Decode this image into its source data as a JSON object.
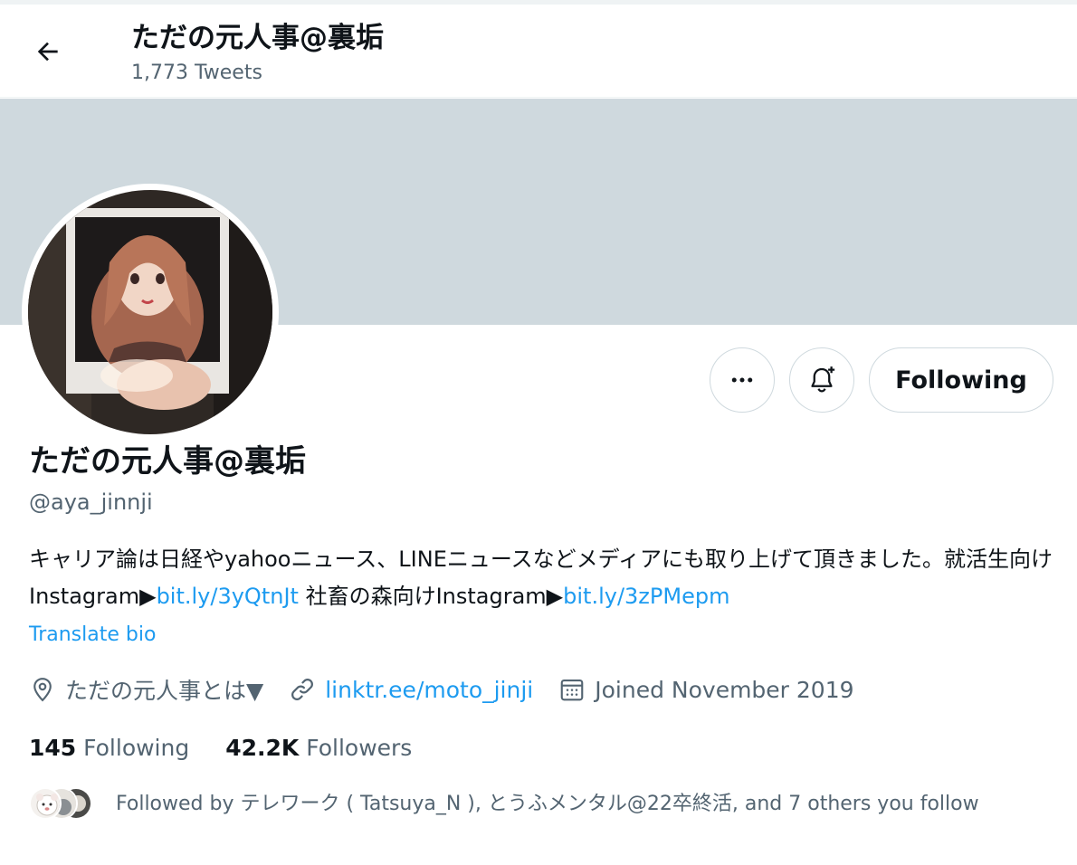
{
  "header": {
    "title": "ただの元人事@裏垢",
    "tweet_count": "1,773 Tweets"
  },
  "actions": {
    "following_label": "Following"
  },
  "profile": {
    "display_name": "ただの元人事@裏垢",
    "handle": "@aya_jinnji",
    "bio": {
      "text_1": "キャリア論は日経やyahooニュース、LINEニュースなどメディアにも取り上げて頂きました。就活生向けInstagram▶",
      "link_1": "bit.ly/3yQtnJt",
      "text_2": " 社畜の森向けInstagram▶",
      "link_2": "bit.ly/3zPMepm"
    },
    "translate_label": "Translate bio",
    "location": "ただの元人事とは▼",
    "website": "linktr.ee/moto_jinji",
    "joined": "Joined November 2019"
  },
  "stats": {
    "following_count": "145",
    "following_label": "Following",
    "followers_count": "42.2K",
    "followers_label": "Followers"
  },
  "followed_by": {
    "text": "Followed by テレワーク ( Tatsuya_N ), とうふメンタル@22卒終活, and 7 others you follow"
  },
  "colors": {
    "accent": "#1d9bf0",
    "banner": "#cfd9de",
    "secondary_text": "#536471",
    "primary_text": "#0f1419"
  },
  "icons": [
    "back-arrow-icon",
    "more-icon",
    "bell-plus-icon",
    "location-icon",
    "link-icon",
    "calendar-icon"
  ]
}
